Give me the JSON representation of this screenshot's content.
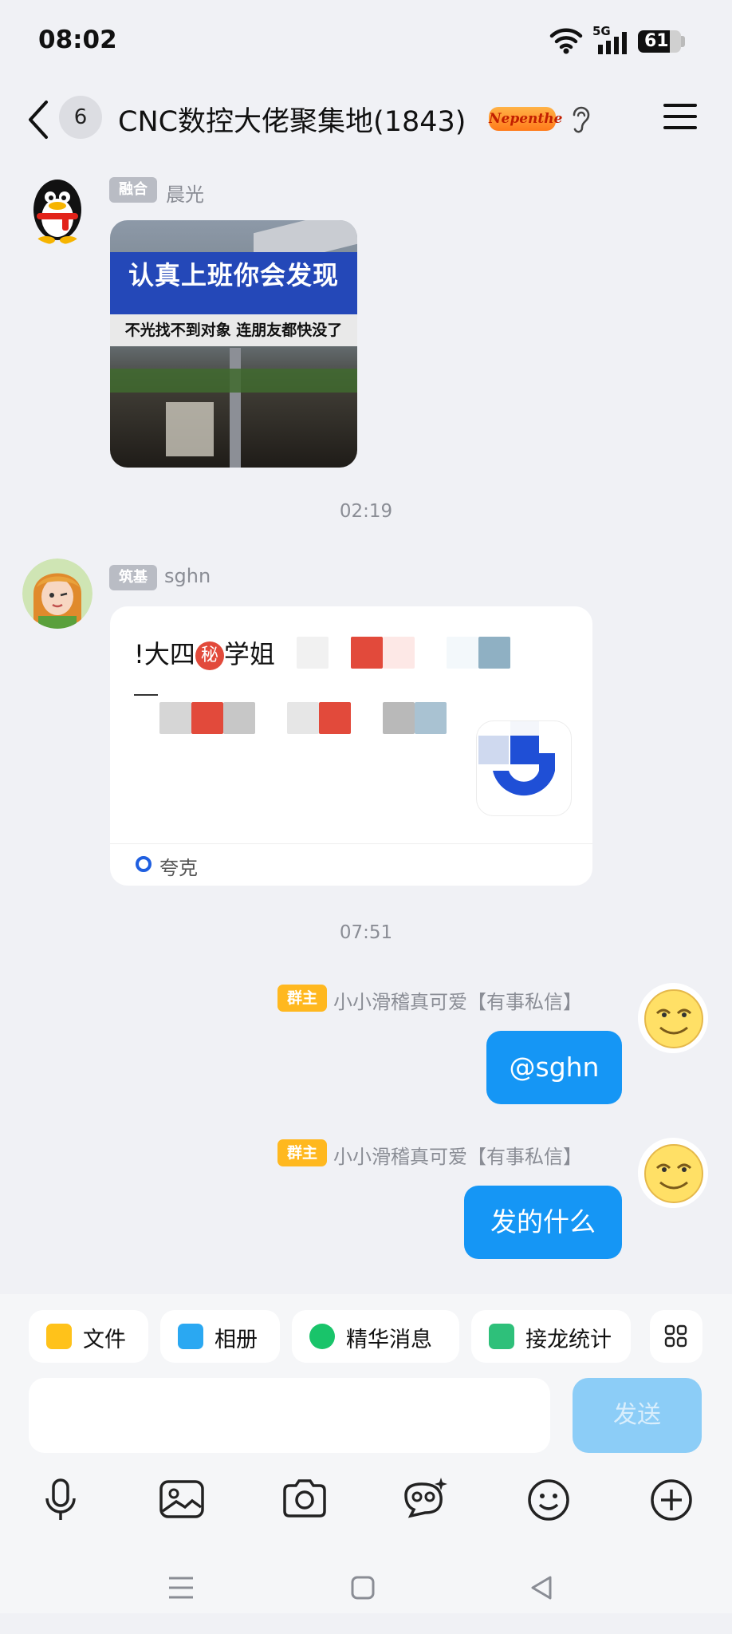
{
  "status_bar": {
    "time": "08:02",
    "network": "5G",
    "battery": "61"
  },
  "header": {
    "unread_count": "6",
    "title": "CNC数控大佬聚集地(1843)",
    "badge": "Nepenthe"
  },
  "messages": [
    {
      "tag": "融合",
      "sender": "晨光",
      "image_text_main": "认真上班你会发现",
      "image_text_sub": "不光找不到对象 连朋友都快没了"
    },
    {
      "timestamp": "02:19"
    },
    {
      "tag": "筑基",
      "sender": "sghn",
      "card_title_a": "!大四",
      "card_secret": "秘",
      "card_title_b": "学姐",
      "card_source": "夸克"
    },
    {
      "timestamp": "07:51"
    },
    {
      "tag": "群主",
      "sender": "小小滑稽真可爱【有事私信】",
      "text": "@sghn"
    },
    {
      "tag": "群主",
      "sender": "小小滑稽真可爱【有事私信】",
      "text": "发的什么"
    }
  ],
  "quick_actions": [
    "文件",
    "相册",
    "精华消息",
    "接龙统计"
  ],
  "input": {
    "send_label": "发送"
  }
}
